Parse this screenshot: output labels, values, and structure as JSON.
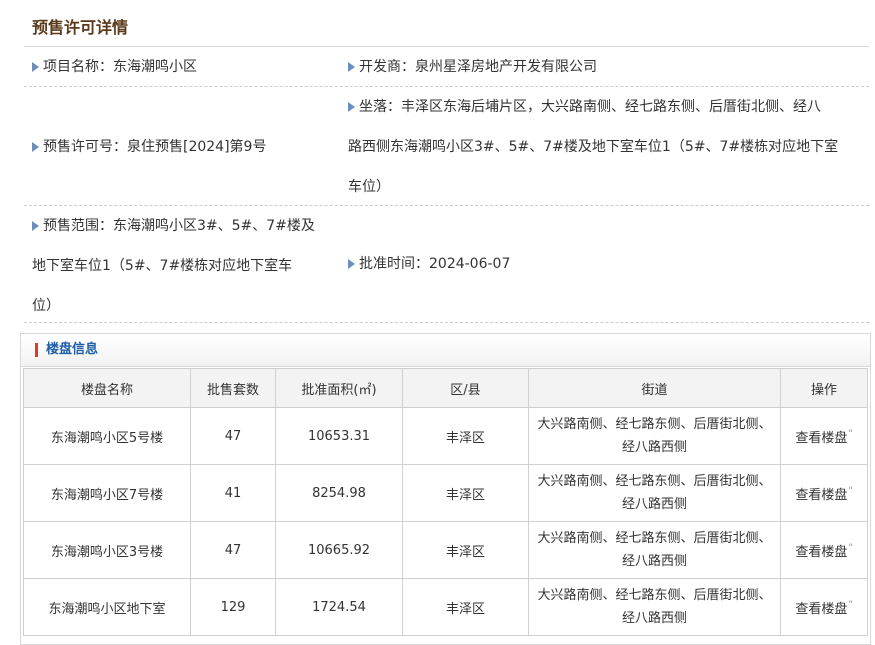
{
  "page_title": "预售许可详情",
  "project": {
    "label": "项目名称：",
    "value": "东海潮鸣小区"
  },
  "developer": {
    "label": "开发商：",
    "value": "泉州星泽房地产开发有限公司"
  },
  "permit": {
    "label": "预售许可号：",
    "value": "泉住预售[2024]第9号"
  },
  "location": {
    "label": "坐落：",
    "lines": [
      "丰泽区东海后埔片区，大兴路南侧、经七路东侧、后厝街北侧、经八",
      "路西侧东海潮鸣小区3#、5#、7#楼及地下室车位1（5#、7#楼栋对应地下室",
      "车位）"
    ]
  },
  "scope": {
    "label": "预售范围：",
    "lines": [
      "东海潮鸣小区3#、5#、7#楼及",
      "地下室车位1（5#、7#楼栋对应地下室车",
      "位）"
    ]
  },
  "approval": {
    "label": "批准时间：",
    "value": "2024-06-07"
  },
  "building_panel": {
    "title": "楼盘信息",
    "columns": [
      "楼盘名称",
      "批售套数",
      "批准面积(㎡)",
      "区/县",
      "街道",
      "操作"
    ],
    "rows": [
      {
        "name": "东海潮鸣小区5号楼",
        "units": "47",
        "area": "10653.31",
        "district": "丰泽区",
        "street_1": "大兴路南侧、经七路东侧、后厝街北侧、",
        "street_2": "经八路西侧",
        "action": "查看楼盘"
      },
      {
        "name": "东海潮鸣小区7号楼",
        "units": "41",
        "area": "8254.98",
        "district": "丰泽区",
        "street_1": "大兴路南侧、经七路东侧、后厝街北侧、",
        "street_2": "经八路西侧",
        "action": "查看楼盘"
      },
      {
        "name": "东海潮鸣小区3号楼",
        "units": "47",
        "area": "10665.92",
        "district": "丰泽区",
        "street_1": "大兴路南侧、经七路东侧、后厝街北侧、",
        "street_2": "经八路西侧",
        "action": "查看楼盘"
      },
      {
        "name": "东海潮鸣小区地下室",
        "units": "129",
        "area": "1724.54",
        "district": "丰泽区",
        "street_1": "大兴路南侧、经七路东侧、后厝街北侧、",
        "street_2": "经八路西侧",
        "action": "查看楼盘"
      }
    ]
  },
  "colors": {
    "title": "#5a3a1a",
    "bullet": "#6e8fbe",
    "panel_title": "#1f5fa8",
    "panel_bar": "#e03b2a"
  }
}
